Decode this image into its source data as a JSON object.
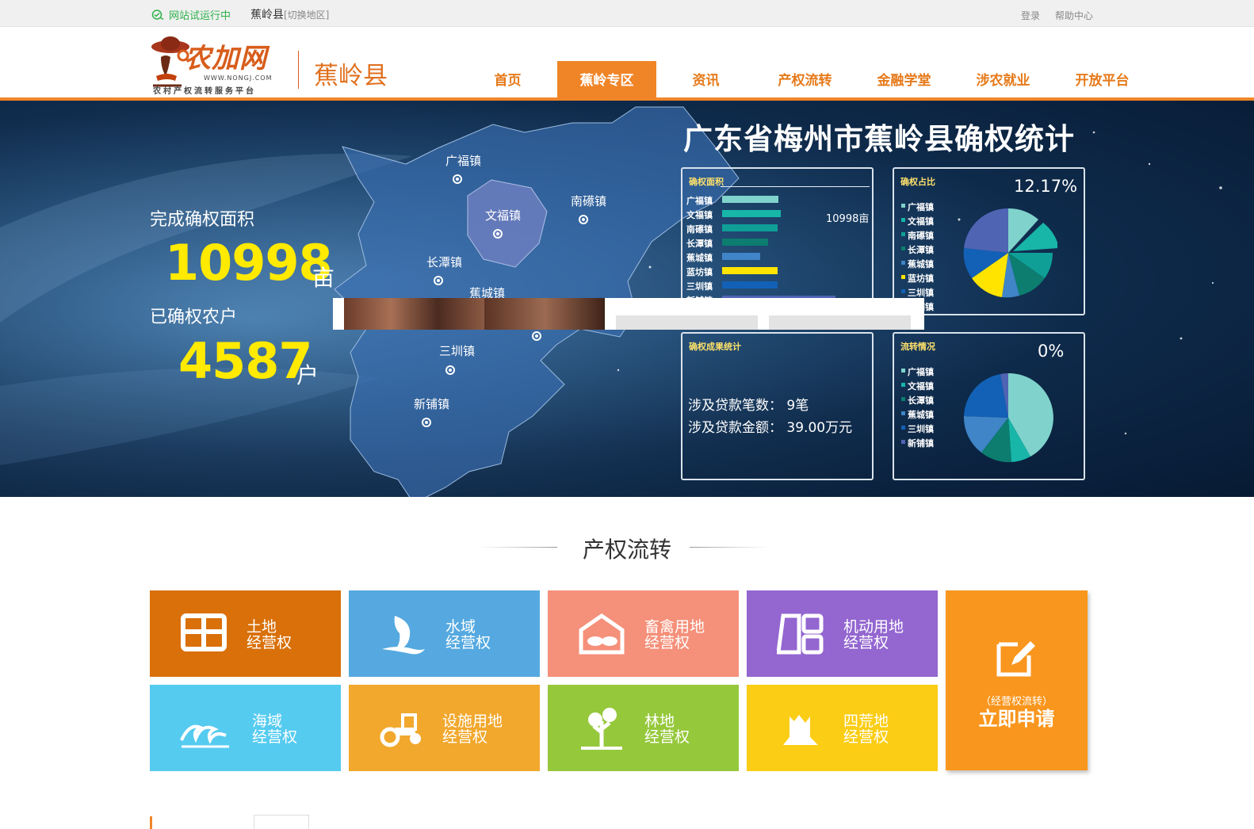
{
  "topbar": {
    "trial": "网站试运行中",
    "county": "蕉岭县",
    "switch": "[切换地区]",
    "login": "登录",
    "help": "帮助中心"
  },
  "header": {
    "brand": "农加网",
    "url": "WWW.NONGJ.COM",
    "slogan": "农村产权流转服务平台",
    "region": "蕉岭县"
  },
  "nav": [
    {
      "label": "首页",
      "active": false
    },
    {
      "label": "蕉岭专区",
      "active": true
    },
    {
      "label": "资讯",
      "active": false
    },
    {
      "label": "产权流转",
      "active": false
    },
    {
      "label": "金融学堂",
      "active": false
    },
    {
      "label": "涉农就业",
      "active": false
    },
    {
      "label": "开放平台",
      "active": false
    }
  ],
  "banner": {
    "title": "广东省梅州市蕉岭县确权统计",
    "area_label": "完成确权面积",
    "area_value": "10998",
    "area_unit": "亩",
    "households_label": "已确权农户",
    "households_value": "4587",
    "households_unit": "户",
    "towns": [
      "广福镇",
      "文福镇",
      "南礤镇",
      "长潭镇",
      "蕉城镇",
      "三圳镇",
      "新铺镇"
    ]
  },
  "panels": {
    "area": {
      "title": "确权面积",
      "value_label": "10998亩",
      "rows": [
        {
          "name": "广福镇",
          "value": 0.62,
          "color": "#7fd3cc"
        },
        {
          "name": "文福镇",
          "value": 0.64,
          "color": "#17b6a8"
        },
        {
          "name": "南礤镇",
          "value": 0.61,
          "color": "#0f9f97"
        },
        {
          "name": "长潭镇",
          "value": 0.5,
          "color": "#0c7d6f"
        },
        {
          "name": "蕉城镇",
          "value": 0.42,
          "color": "#3f85c7"
        },
        {
          "name": "蓝坊镇",
          "value": 0.61,
          "color": "#ffe400"
        },
        {
          "name": "三圳镇",
          "value": 0.61,
          "color": "#1261b6"
        },
        {
          "name": "新铺镇",
          "value": 1.24,
          "color": "#5064b4"
        }
      ]
    },
    "ratio": {
      "title": "确权占比",
      "percent": "12.17%",
      "legend": [
        {
          "name": "广福镇",
          "color": "#7fd3cc"
        },
        {
          "name": "文福镇",
          "color": "#17b6a8"
        },
        {
          "name": "南礤镇",
          "color": "#0f9f97"
        },
        {
          "name": "长潭镇",
          "color": "#0c7d6f"
        },
        {
          "name": "蕉城镇",
          "color": "#3f85c7"
        },
        {
          "name": "蓝坊镇",
          "color": "#ffe400"
        },
        {
          "name": "三圳镇",
          "color": "#1261b6"
        },
        {
          "name": "新铺镇",
          "color": "#5064b4"
        }
      ]
    },
    "results": {
      "title": "确权成果统计",
      "loans_count_label": "涉及贷款笔数：",
      "loans_count_value": "9笔",
      "loans_amount_label": "涉及贷款金额：",
      "loans_amount_value": "39.00万元"
    },
    "transfer": {
      "title": "流转情况",
      "percent": "0%",
      "legend": [
        {
          "name": "广福镇",
          "color": "#7fd3cc"
        },
        {
          "name": "文福镇",
          "color": "#17b6a8"
        },
        {
          "name": "长潭镇",
          "color": "#0c7d6f"
        },
        {
          "name": "蕉城镇",
          "color": "#3f85c7"
        },
        {
          "name": "三圳镇",
          "color": "#1261b6"
        },
        {
          "name": "新铺镇",
          "color": "#5064b4"
        }
      ]
    }
  },
  "section": {
    "title": "产权流转"
  },
  "tiles": [
    {
      "line1": "土地",
      "line2": "经营权",
      "color": "#d9700a",
      "icon": "land-grid-icon"
    },
    {
      "line1": "水域",
      "line2": "经营权",
      "color": "#55a9e0",
      "icon": "fish-icon"
    },
    {
      "line1": "畜禽用地",
      "line2": "经营权",
      "color": "#f5907a",
      "icon": "livestock-barn-icon"
    },
    {
      "line1": "机动用地",
      "line2": "经营权",
      "color": "#9366d0",
      "icon": "flexible-land-icon"
    },
    {
      "line1": "海域",
      "line2": "经营权",
      "color": "#56cbf0",
      "icon": "sea-wave-icon"
    },
    {
      "line1": "设施用地",
      "line2": "经营权",
      "color": "#f2a82d",
      "icon": "tractor-icon"
    },
    {
      "line1": "林地",
      "line2": "经营权",
      "color": "#96c83c",
      "icon": "tree-icon"
    },
    {
      "line1": "四荒地",
      "line2": "经营权",
      "color": "#fbcd15",
      "icon": "tree-stump-icon"
    }
  ],
  "apply": {
    "sub": "（经营权流转）",
    "main": "立即申请"
  }
}
